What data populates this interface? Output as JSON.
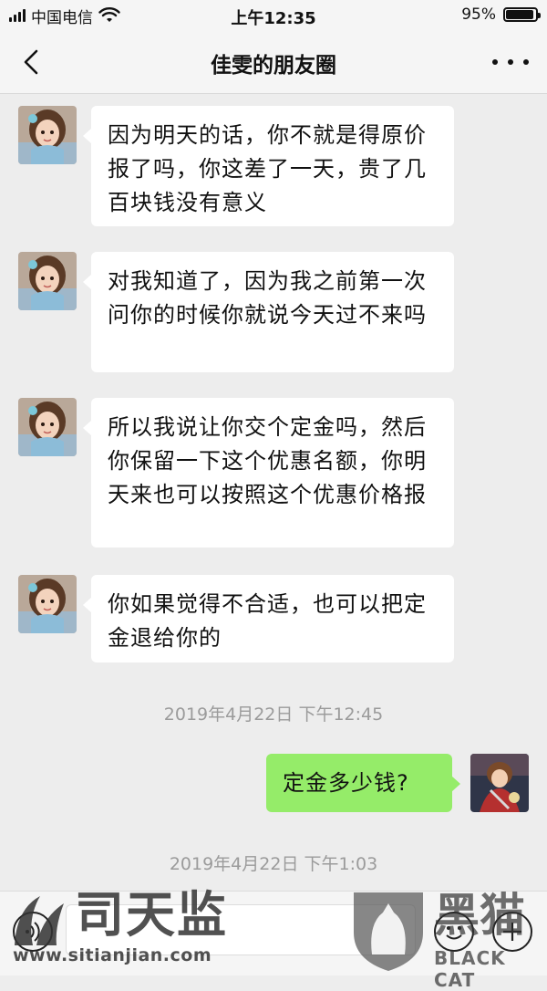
{
  "status_bar": {
    "carrier": "中国电信",
    "time": "上午12:35",
    "battery": "95%",
    "battery_level": 0.95
  },
  "nav": {
    "title": "佳雯的朋友圈",
    "back_icon": "chevron-left-icon",
    "more_icon": "more-dots-icon"
  },
  "messages": [
    {
      "side": "left",
      "text": "因为明天的话，你不就是得原价报了吗，你这差了一天，贵了几百块钱没有意义"
    },
    {
      "side": "left",
      "text": "对我知道了，因为我之前第一次问你的时候你就说今天过不来吗"
    },
    {
      "side": "left",
      "text": "所以我说让你交个定金吗，然后你保留一下这个优惠名额，你明天来也可以按照这个优惠价格报"
    },
    {
      "side": "left",
      "text": "你如果觉得不合适，也可以把定金退给你的"
    },
    {
      "side": "right",
      "text": "定金多少钱?"
    }
  ],
  "timestamps": [
    "2019年4月22日 下午12:45",
    "2019年4月22日 下午1:03"
  ],
  "input_bar": {
    "value": "",
    "icons": [
      "voice-icon",
      "emoji-icon",
      "plus-icon"
    ]
  },
  "watermarks": {
    "left_name": "司天监",
    "left_url": "www.sitianjian.com",
    "right_cn": "黑猫",
    "right_en": "BLACK CAT"
  },
  "colors": {
    "background": "#ededed",
    "bubble_left": "#ffffff",
    "bubble_right": "#95ec69",
    "timestamp": "#9b9b9b"
  }
}
